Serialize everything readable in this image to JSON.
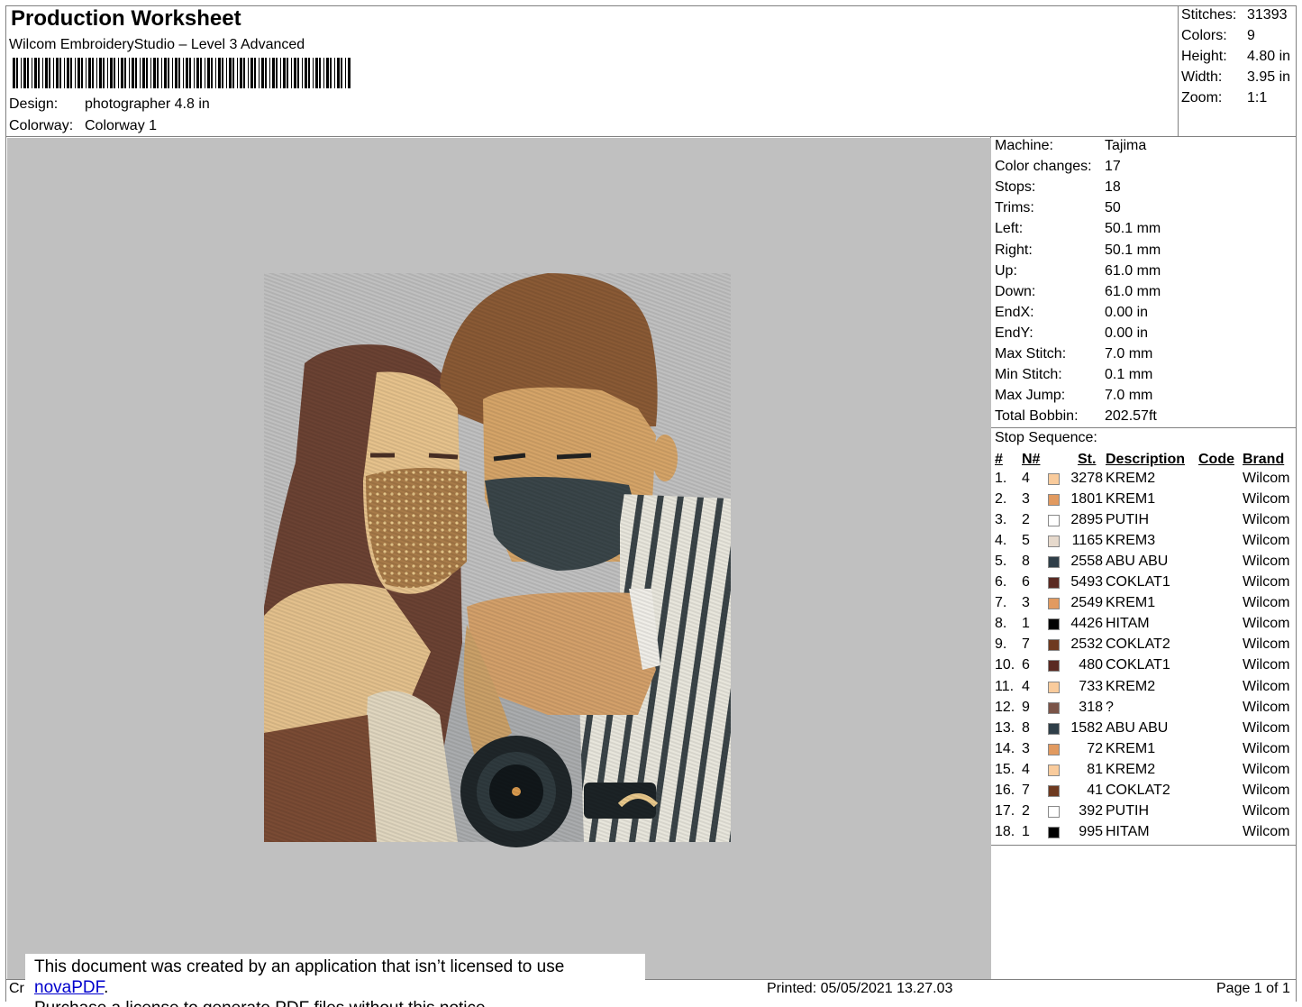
{
  "header": {
    "title": "Production Worksheet",
    "subtitle": "Wilcom EmbroideryStudio – Level 3 Advanced",
    "design_label": "Design:",
    "design_value": "photographer 4.8 in",
    "colorway_label": "Colorway:",
    "colorway_value": "Colorway 1"
  },
  "summary": [
    {
      "label": "Stitches:",
      "value": "31393"
    },
    {
      "label": "Colors:",
      "value": "9"
    },
    {
      "label": "Height:",
      "value": "4.80 in"
    },
    {
      "label": "Width:",
      "value": "3.95 in"
    },
    {
      "label": "Zoom:",
      "value": "1:1"
    }
  ],
  "machine_info": [
    {
      "label": "Machine:",
      "value": "Tajima"
    },
    {
      "label": "Color changes:",
      "value": "17"
    },
    {
      "label": "Stops:",
      "value": "18"
    },
    {
      "label": "Trims:",
      "value": "50"
    },
    {
      "label": "Left:",
      "value": "50.1 mm"
    },
    {
      "label": "Right:",
      "value": "50.1 mm"
    },
    {
      "label": "Up:",
      "value": "61.0 mm"
    },
    {
      "label": "Down:",
      "value": "61.0 mm"
    },
    {
      "label": "EndX:",
      "value": "0.00 in"
    },
    {
      "label": "EndY:",
      "value": "0.00 in"
    },
    {
      "label": "Max Stitch:",
      "value": "7.0 mm"
    },
    {
      "label": "Min Stitch:",
      "value": "0.1 mm"
    },
    {
      "label": "Max Jump:",
      "value": "7.0 mm"
    },
    {
      "label": "Total Bobbin:",
      "value": "202.57ft"
    }
  ],
  "stop_sequence": {
    "title": "Stop Sequence:",
    "headers": {
      "idx": "#",
      "n": "N#",
      "st": "St.",
      "desc": "Description",
      "code": "Code",
      "brand": "Brand"
    },
    "rows": [
      {
        "idx": "1.",
        "n": "4",
        "color": "#f9cb9c",
        "st": "3278",
        "desc": "KREM2",
        "brand": "Wilcom"
      },
      {
        "idx": "2.",
        "n": "3",
        "color": "#e19a60",
        "st": "1801",
        "desc": "KREM1",
        "brand": "Wilcom"
      },
      {
        "idx": "3.",
        "n": "2",
        "color": "#ffffff",
        "st": "2895",
        "desc": "PUTIH",
        "brand": "Wilcom"
      },
      {
        "idx": "4.",
        "n": "5",
        "color": "#e6d9cc",
        "st": "1165",
        "desc": "KREM3",
        "brand": "Wilcom"
      },
      {
        "idx": "5.",
        "n": "8",
        "color": "#2f3e48",
        "st": "2558",
        "desc": "ABU ABU",
        "brand": "Wilcom"
      },
      {
        "idx": "6.",
        "n": "6",
        "color": "#5a2a22",
        "st": "5493",
        "desc": "COKLAT1",
        "brand": "Wilcom"
      },
      {
        "idx": "7.",
        "n": "3",
        "color": "#e19a60",
        "st": "2549",
        "desc": "KREM1",
        "brand": "Wilcom"
      },
      {
        "idx": "8.",
        "n": "1",
        "color": "#000000",
        "st": "4426",
        "desc": "HITAM",
        "brand": "Wilcom"
      },
      {
        "idx": "9.",
        "n": "7",
        "color": "#6e3a20",
        "st": "2532",
        "desc": "COKLAT2",
        "brand": "Wilcom"
      },
      {
        "idx": "10.",
        "n": "6",
        "color": "#5a2a22",
        "st": "480",
        "desc": "COKLAT1",
        "brand": "Wilcom"
      },
      {
        "idx": "11.",
        "n": "4",
        "color": "#f9cb9c",
        "st": "733",
        "desc": "KREM2",
        "brand": "Wilcom"
      },
      {
        "idx": "12.",
        "n": "9",
        "color": "#7a5448",
        "st": "318",
        "desc": "?",
        "brand": "Wilcom"
      },
      {
        "idx": "13.",
        "n": "8",
        "color": "#2f3e48",
        "st": "1582",
        "desc": "ABU ABU",
        "brand": "Wilcom"
      },
      {
        "idx": "14.",
        "n": "3",
        "color": "#e19a60",
        "st": "72",
        "desc": "KREM1",
        "brand": "Wilcom"
      },
      {
        "idx": "15.",
        "n": "4",
        "color": "#f9cb9c",
        "st": "81",
        "desc": "KREM2",
        "brand": "Wilcom"
      },
      {
        "idx": "16.",
        "n": "7",
        "color": "#6e3a20",
        "st": "41",
        "desc": "COKLAT2",
        "brand": "Wilcom"
      },
      {
        "idx": "17.",
        "n": "2",
        "color": "#ffffff",
        "st": "392",
        "desc": "PUTIH",
        "brand": "Wilcom"
      },
      {
        "idx": "18.",
        "n": "1",
        "color": "#000000",
        "st": "995",
        "desc": "HITAM",
        "brand": "Wilcom"
      }
    ]
  },
  "footer": {
    "left_stub": "Cr",
    "printed": "Printed: 05/05/2021 13.27.03",
    "page": "Page 1 of 1"
  },
  "notice": {
    "line1_prefix": "This document was created by an application that isn’t licensed to use ",
    "link": "novaPDF",
    "line1_suffix": ".",
    "line2": "Purchase a license to generate PDF files without this notice."
  }
}
